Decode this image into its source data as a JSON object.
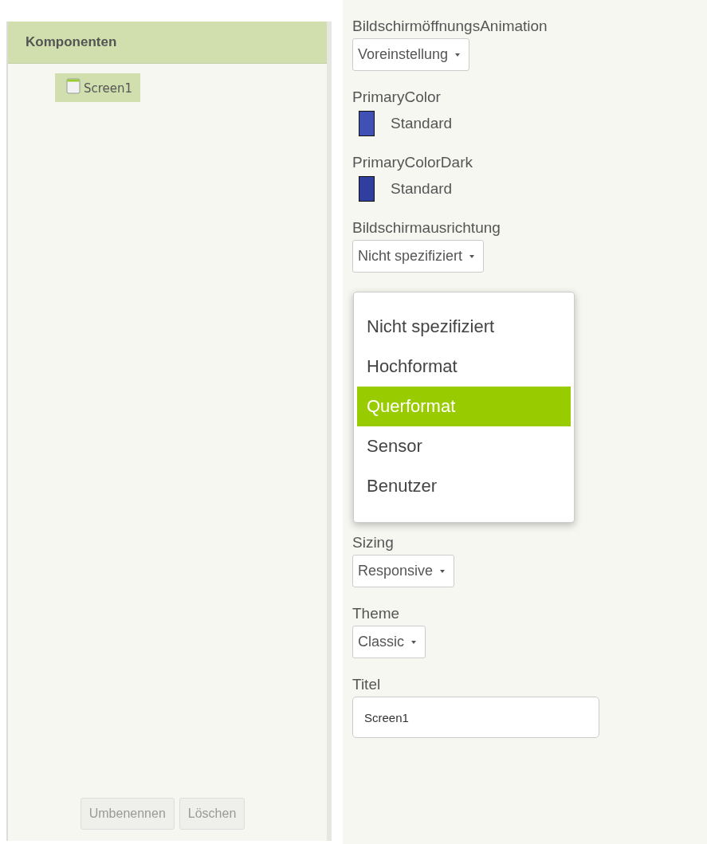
{
  "components": {
    "title": "Komponenten",
    "items": [
      {
        "label": "Screen1",
        "selected": true
      }
    ],
    "buttons": [
      {
        "label": "Umbenennen",
        "disabled": true
      },
      {
        "label": "Löschen",
        "disabled": true
      }
    ]
  },
  "properties": [
    {
      "kind": "dropdown",
      "label": "BildschirmöffnungsAnimation",
      "value": "Voreinstellung"
    },
    {
      "kind": "color",
      "label": "PrimaryColor",
      "value": "Standard",
      "color": "#3f51b5"
    },
    {
      "kind": "color",
      "label": "PrimaryColorDark",
      "value": "Standard",
      "color": "#303f9f"
    },
    {
      "kind": "dropdown",
      "label": "Bildschirmausrichtung",
      "value": "Nicht spezifiziert",
      "open": true
    },
    {
      "kind": "dropdown",
      "label": "Sizing",
      "value": "Responsive"
    },
    {
      "kind": "dropdown",
      "label": "Theme",
      "value": "Classic"
    },
    {
      "kind": "textbox",
      "label": "Titel",
      "value": "Screen1"
    }
  ],
  "menu": {
    "options": [
      {
        "label": "Nicht spezifiziert",
        "selected": false
      },
      {
        "label": "Hochformat",
        "selected": false
      },
      {
        "label": "Querformat",
        "selected": true
      },
      {
        "label": "Sensor",
        "selected": false
      },
      {
        "label": "Benutzer",
        "selected": false
      }
    ]
  }
}
